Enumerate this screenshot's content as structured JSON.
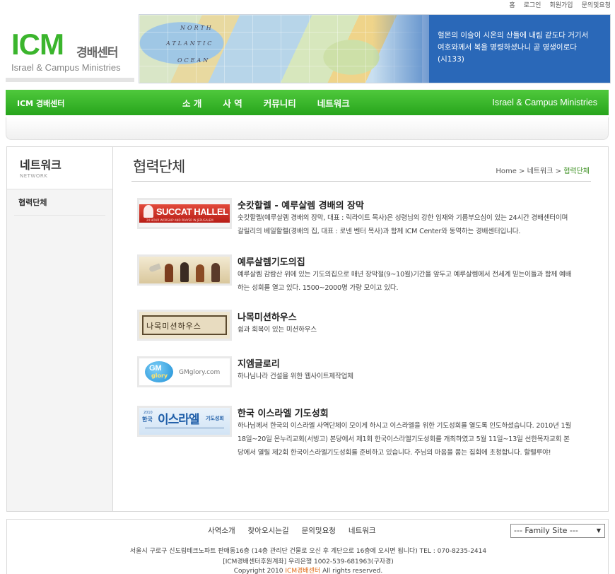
{
  "util_links": [
    "홈",
    "로그인",
    "회원가입",
    "문의및요청"
  ],
  "logo": {
    "icm": "ICM",
    "korean": "경배센터",
    "english": "Israel & Campus Ministries"
  },
  "banner": {
    "map_labels": [
      "NORTH",
      "ATLANTIC",
      "OCEAN"
    ],
    "verse": [
      "헐몬의 이슬이 시온의 산들에 내림 같도다 거기서",
      "여호와께서 복을 명령하셨나니 곧 영생이로다",
      "(시133)"
    ]
  },
  "nav": {
    "home": "ICM 경배센터",
    "items": [
      "소 개",
      "사 역",
      "커뮤니티",
      "네트워크"
    ],
    "tagline": "Israel & Campus Ministries"
  },
  "sidebar": {
    "title": "네트워크",
    "subtitle": "NETWORK",
    "items": [
      "협력단체"
    ]
  },
  "content": {
    "title": "협력단체",
    "breadcrumb": {
      "home": "Home",
      "section": "네트워크",
      "current": "협력단체",
      "sep": ">"
    }
  },
  "orgs": [
    {
      "name": "숫캇할렐 - 예루살렘 경배의 장막",
      "logo_text": "SUCCAT HALLEL",
      "logo_sub": "24 HOUR WORSHIP AND PRAYER IN JERUSALEM",
      "desc": "숫캇할렐(예루살렘 경배의 장막, 대표 : 릭라이트 목사)은 성령님의 강한 임재와 기름부으심이 있는 24시간 경배센터이며 갈릴리의 베일할렐(경배의 집, 대표 : 로넨 벤터 목사)과 함께 ICM Center와 동역하는 경배센터입니다."
    },
    {
      "name": "예루살렘기도의집",
      "logo_text": "",
      "desc": "예루살렘 감람산 위에 있는 기도의집으로 매년 장막절(9~10월)기간을 앞두고 예루살렘에서 전세계 믿는이들과 함께 예배하는 성회를 열고 있다. 1500~2000명 가량 모이고 있다."
    },
    {
      "name": "나목미션하우스",
      "logo_text": "나목미션하우스",
      "desc": "쉼과 회복이 있는 미션하우스"
    },
    {
      "name": "지엠글로리",
      "logo_text": "GMglory.com",
      "logo_mark": "GM",
      "logo_mark2": "glory",
      "desc": "하나님나라 건설을 위한 웹사이트제작업체"
    },
    {
      "name": "한국 이스라엘 기도성회",
      "logo_year": "2010",
      "logo_kr": "한국",
      "logo_text": "이스라엘",
      "logo_suffix": "기도성회",
      "desc": "하나님께서 한국의 이스라엘 사역단체이 모이게 하시고 이스라엘을 위한 기도성회를 열도록 인도하셨습니다. 2010년 1월 18일~20일 온누리교회(서빙고) 본당에서 제1회 한국이스라엘기도성회를 개최하였고 5월 11일~13일 선한목자교회 본당에서 열릴 제2회 한국이스라엘기도성회를 준비하고 있습니다. 주님의 마음을 품는 집회에 초청합니다. 할렐루야!"
    }
  ],
  "footer": {
    "links": [
      "사역소개",
      "찾아오시는길",
      "문의및요청",
      "네트워크"
    ],
    "family_site": "--- Family Site ---",
    "address": "서울시 구로구 신도림테크노파트 판매동16층 (14층 관리단 건물로 오신 후 계단으로 16층에 오시면 됩니다)   TEL : 070-8235-2414",
    "account": "[ICM경배센터후원계좌] 우리은행 1002-539-681963(구자경)",
    "copyright_pre": "Copyright 2010",
    "copyright_brand": "ICM경배센터",
    "copyright_post": "All rights reserved."
  },
  "colors": {
    "green": "#33b026",
    "banner_blue": "#2a68b8",
    "link_green": "#3a8f1f",
    "brand_orange": "#e06a15"
  }
}
